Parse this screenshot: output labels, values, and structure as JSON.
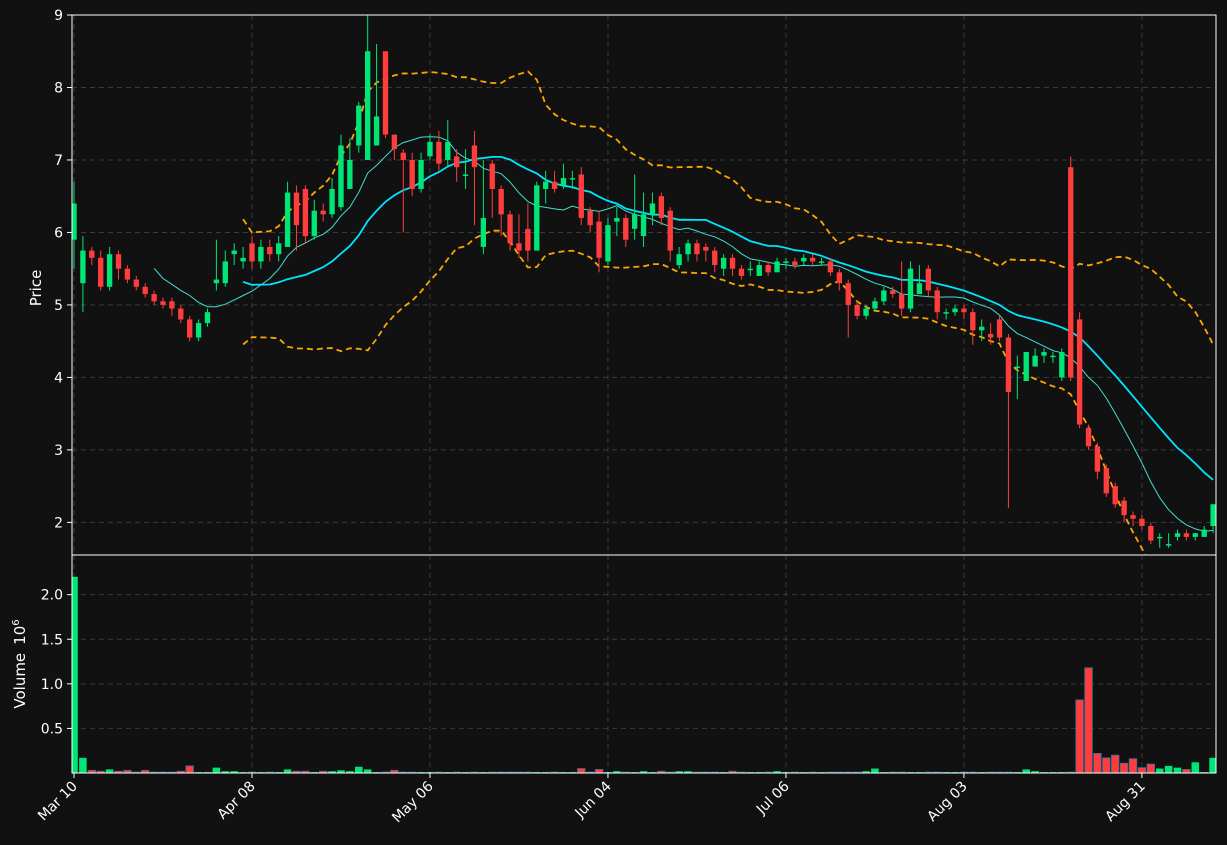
{
  "chart_data": {
    "type": "candlestick",
    "dates": [
      "Mar 10",
      "Mar 11",
      "Mar 12",
      "Mar 13",
      "Mar 14",
      "Mar 17",
      "Mar 18",
      "Mar 19",
      "Mar 20",
      "Mar 21",
      "Mar 24",
      "Mar 25",
      "Mar 26",
      "Mar 27",
      "Mar 28",
      "Mar 31",
      "Apr 01",
      "Apr 02",
      "Apr 03",
      "Apr 04",
      "Apr 07",
      "Apr 08",
      "Apr 09",
      "Apr 10",
      "Apr 11",
      "Apr 14",
      "Apr 15",
      "Apr 16",
      "Apr 17",
      "Apr 18",
      "Apr 21",
      "Apr 22",
      "Apr 23",
      "Apr 24",
      "Apr 25",
      "Apr 28",
      "Apr 29",
      "Apr 30",
      "May 01",
      "May 02",
      "May 05",
      "May 06",
      "May 07",
      "May 08",
      "May 09",
      "May 12",
      "May 13",
      "May 14",
      "May 15",
      "May 16",
      "May 19",
      "May 20",
      "May 21",
      "May 22",
      "May 23",
      "May 27",
      "May 28",
      "May 29",
      "May 30",
      "Jun 02",
      "Jun 03",
      "Jun 04",
      "Jun 05",
      "Jun 06",
      "Jun 09",
      "Jun 10",
      "Jun 11",
      "Jun 12",
      "Jun 13",
      "Jun 16",
      "Jun 17",
      "Jun 18",
      "Jun 19",
      "Jun 20",
      "Jun 23",
      "Jun 24",
      "Jun 25",
      "Jun 26",
      "Jun 27",
      "Jun 30",
      "Jul 01",
      "Jul 02",
      "Jul 03",
      "Jul 06",
      "Jul 07",
      "Jul 08",
      "Jul 09",
      "Jul 10",
      "Jul 11",
      "Jul 14",
      "Jul 15",
      "Jul 16",
      "Jul 17",
      "Jul 18",
      "Jul 21",
      "Jul 22",
      "Jul 23",
      "Jul 24",
      "Jul 25",
      "Jul 28",
      "Jul 29",
      "Jul 30",
      "Jul 31",
      "Aug 01",
      "Aug 03",
      "Aug 04",
      "Aug 05",
      "Aug 06",
      "Aug 07",
      "Aug 08",
      "Aug 11",
      "Aug 12",
      "Aug 13",
      "Aug 14",
      "Aug 15",
      "Aug 18",
      "Aug 19",
      "Aug 20",
      "Aug 21",
      "Aug 22",
      "Aug 25",
      "Aug 26",
      "Aug 27",
      "Aug 28",
      "Aug 29",
      "Aug 31",
      "Sep 01",
      "Sep 02",
      "Sep 03",
      "Sep 04",
      "Sep 05"
    ],
    "open": [
      5.9,
      5.3,
      5.75,
      5.65,
      5.25,
      5.7,
      5.5,
      5.35,
      5.25,
      5.15,
      5.05,
      5.05,
      4.95,
      4.8,
      4.55,
      4.75,
      5.3,
      5.3,
      5.7,
      5.6,
      5.85,
      5.6,
      5.8,
      5.7,
      5.8,
      6.55,
      6.6,
      5.95,
      6.3,
      6.25,
      6.35,
      6.6,
      7.2,
      7.0,
      7.2,
      8.5,
      7.35,
      7.1,
      7.0,
      6.6,
      7.05,
      7.25,
      7.0,
      7.05,
      6.8,
      7.2,
      5.8,
      6.95,
      6.6,
      6.25,
      5.85,
      6.05,
      5.75,
      6.6,
      6.7,
      6.65,
      6.75,
      6.8,
      6.3,
      6.15,
      5.6,
      6.15,
      6.2,
      6.05,
      5.95,
      6.25,
      6.5,
      6.3,
      5.55,
      5.7,
      5.85,
      5.8,
      5.75,
      5.5,
      5.65,
      5.5,
      5.5,
      5.4,
      5.55,
      5.45,
      5.6,
      5.6,
      5.6,
      5.65,
      5.6,
      5.6,
      5.45,
      5.3,
      5.0,
      4.85,
      4.95,
      5.05,
      5.2,
      5.15,
      4.95,
      5.15,
      5.5,
      5.2,
      4.9,
      4.9,
      4.95,
      4.9,
      4.65,
      4.6,
      4.8,
      4.55,
      4.15,
      3.95,
      4.15,
      4.3,
      4.3,
      4.0,
      6.9,
      4.8,
      3.3,
      3.05,
      2.75,
      2.5,
      2.3,
      2.1,
      2.05,
      1.95,
      1.8,
      1.7,
      1.8,
      1.85,
      1.8,
      1.8,
      1.95
    ],
    "close": [
      6.4,
      5.75,
      5.65,
      5.25,
      5.7,
      5.5,
      5.35,
      5.25,
      5.15,
      5.05,
      5.0,
      4.95,
      4.8,
      4.55,
      4.75,
      4.9,
      5.35,
      5.6,
      5.75,
      5.65,
      5.6,
      5.8,
      5.7,
      5.85,
      6.55,
      6.1,
      5.95,
      6.3,
      6.25,
      6.6,
      7.2,
      7.0,
      7.75,
      8.5,
      7.6,
      7.35,
      7.15,
      7.0,
      6.6,
      7.0,
      7.25,
      6.95,
      7.25,
      6.9,
      6.8,
      6.9,
      6.2,
      6.6,
      6.25,
      5.85,
      5.75,
      5.75,
      6.65,
      6.7,
      6.6,
      6.75,
      6.75,
      6.2,
      6.1,
      5.65,
      6.1,
      6.2,
      5.9,
      6.25,
      6.25,
      6.4,
      6.2,
      5.75,
      5.7,
      5.85,
      5.7,
      5.75,
      5.55,
      5.65,
      5.5,
      5.4,
      5.5,
      5.55,
      5.45,
      5.6,
      5.6,
      5.55,
      5.65,
      5.6,
      5.6,
      5.45,
      5.3,
      5.0,
      4.85,
      4.95,
      5.05,
      5.2,
      5.15,
      4.95,
      5.5,
      5.3,
      5.2,
      4.9,
      4.9,
      4.95,
      4.9,
      4.65,
      4.7,
      4.55,
      4.55,
      3.8,
      4.15,
      4.35,
      4.3,
      4.35,
      4.3,
      4.35,
      4.0,
      3.35,
      3.05,
      2.7,
      2.4,
      2.25,
      2.1,
      2.05,
      1.95,
      1.75,
      1.8,
      1.7,
      1.85,
      1.8,
      1.85,
      1.9,
      2.25
    ],
    "high": [
      6.7,
      5.95,
      5.8,
      5.75,
      5.8,
      5.75,
      5.55,
      5.4,
      5.3,
      5.2,
      5.1,
      5.1,
      5.0,
      4.85,
      4.8,
      4.95,
      5.9,
      5.75,
      5.85,
      5.8,
      5.95,
      5.9,
      5.9,
      5.95,
      6.7,
      6.65,
      6.65,
      6.45,
      6.4,
      6.75,
      7.35,
      7.3,
      7.8,
      9.0,
      8.6,
      7.5,
      7.3,
      7.15,
      7.1,
      7.1,
      7.35,
      7.4,
      7.55,
      7.15,
      7.15,
      7.4,
      7.0,
      7.0,
      6.65,
      6.3,
      6.25,
      6.4,
      6.7,
      6.85,
      6.85,
      6.95,
      6.85,
      6.9,
      6.35,
      6.3,
      6.2,
      6.35,
      6.25,
      6.8,
      6.55,
      6.55,
      6.55,
      6.35,
      5.8,
      5.9,
      5.9,
      5.85,
      5.8,
      5.7,
      5.7,
      5.55,
      5.6,
      5.6,
      5.6,
      5.65,
      5.65,
      5.65,
      5.7,
      5.7,
      5.65,
      5.65,
      5.5,
      5.35,
      5.05,
      5.0,
      5.1,
      5.25,
      5.25,
      5.6,
      5.6,
      5.55,
      5.55,
      5.25,
      4.95,
      5.0,
      5.0,
      4.95,
      4.8,
      4.75,
      4.85,
      4.6,
      4.3,
      4.35,
      4.4,
      4.4,
      4.35,
      4.4,
      7.05,
      4.9,
      3.35,
      3.1,
      2.8,
      2.55,
      2.35,
      2.15,
      2.1,
      2.0,
      1.85,
      1.85,
      1.9,
      1.9,
      1.85,
      1.95,
      2.25
    ],
    "low": [
      5.5,
      4.9,
      5.55,
      5.2,
      5.2,
      5.35,
      5.3,
      5.2,
      5.1,
      5.0,
      4.95,
      4.85,
      4.75,
      4.5,
      4.5,
      4.7,
      5.2,
      5.25,
      5.55,
      5.5,
      5.5,
      5.5,
      5.6,
      5.6,
      5.8,
      5.75,
      5.85,
      5.9,
      6.15,
      6.2,
      6.3,
      6.7,
      7.1,
      7.0,
      7.55,
      7.3,
      7.0,
      6.0,
      6.5,
      6.55,
      7.0,
      6.85,
      6.9,
      6.7,
      6.6,
      6.1,
      5.7,
      6.2,
      5.95,
      5.75,
      5.65,
      5.6,
      5.8,
      6.4,
      6.55,
      6.6,
      6.6,
      6.1,
      6.0,
      5.45,
      5.55,
      5.95,
      5.8,
      5.9,
      5.8,
      6.1,
      6.1,
      5.6,
      5.5,
      5.6,
      5.6,
      5.6,
      5.45,
      5.4,
      5.4,
      5.35,
      5.4,
      5.4,
      5.4,
      5.5,
      5.5,
      5.5,
      5.55,
      5.55,
      5.55,
      5.4,
      5.2,
      4.55,
      4.8,
      4.8,
      4.9,
      5.0,
      5.1,
      4.85,
      4.9,
      5.2,
      5.1,
      4.8,
      4.8,
      4.85,
      4.8,
      4.45,
      4.5,
      4.45,
      4.5,
      2.2,
      3.7,
      4.1,
      4.15,
      4.2,
      4.2,
      3.95,
      3.95,
      3.3,
      3.0,
      2.6,
      2.35,
      2.2,
      2.0,
      1.95,
      1.9,
      1.7,
      1.65,
      1.65,
      1.75,
      1.75,
      1.75,
      1.8,
      1.85
    ],
    "volume_millions": [
      2.2,
      0.17,
      0.03,
      0.02,
      0.04,
      0.02,
      0.03,
      0.01,
      0.03,
      0.01,
      0.01,
      0.01,
      0.02,
      0.08,
      0.01,
      0.01,
      0.06,
      0.02,
      0.02,
      0.01,
      0.01,
      0.01,
      0.01,
      0.01,
      0.04,
      0.02,
      0.02,
      0.01,
      0.02,
      0.02,
      0.03,
      0.02,
      0.07,
      0.04,
      0.01,
      0.01,
      0.03,
      0.01,
      0.01,
      0.01,
      0.01,
      0.01,
      0.01,
      0.01,
      0.01,
      0.01,
      0.01,
      0.01,
      0.01,
      0.01,
      0.01,
      0.01,
      0.01,
      0.01,
      0.01,
      0.01,
      0.01,
      0.05,
      0.01,
      0.04,
      0.01,
      0.02,
      0.01,
      0.01,
      0.02,
      0.01,
      0.02,
      0.01,
      0.02,
      0.02,
      0.01,
      0.01,
      0.01,
      0.01,
      0.02,
      0.01,
      0.01,
      0.01,
      0.01,
      0.02,
      0.01,
      0.01,
      0.01,
      0.01,
      0.01,
      0.01,
      0.01,
      0.01,
      0.01,
      0.02,
      0.05,
      0.01,
      0.01,
      0.01,
      0.01,
      0.01,
      0.01,
      0.01,
      0.01,
      0.01,
      0.01,
      0.01,
      0.01,
      0.01,
      0.01,
      0.01,
      0.01,
      0.04,
      0.02,
      0.01,
      0.01,
      0.01,
      0.01,
      0.82,
      1.18,
      0.22,
      0.17,
      0.2,
      0.11,
      0.16,
      0.06,
      0.1,
      0.05,
      0.08,
      0.06,
      0.04,
      0.12,
      0.01,
      0.17,
      0.09,
      0.15
    ],
    "x_ticks": [
      {
        "label": "Mar 10",
        "index": 0
      },
      {
        "label": "Apr 08",
        "index": 20
      },
      {
        "label": "May 06",
        "index": 40
      },
      {
        "label": "Jun 04",
        "index": 60
      },
      {
        "label": "Jul 06",
        "index": 80
      },
      {
        "label": "Aug 03",
        "index": 100
      },
      {
        "label": "Aug 31",
        "index": 120
      }
    ],
    "price_axis": {
      "label": "Price",
      "ylim": [
        1.55,
        9.0
      ],
      "ticks": [
        2,
        3,
        4,
        5,
        6,
        7,
        8,
        9
      ]
    },
    "volume_axis": {
      "label": "Volume",
      "unit_power": "6",
      "ylim": [
        0,
        2.4
      ],
      "ticks": [
        {
          "value": 0.5,
          "label": "0.5"
        },
        {
          "value": 1.0,
          "label": "1.0"
        },
        {
          "value": 1.5,
          "label": "1.5"
        },
        {
          "value": 2.0,
          "label": "2.0"
        }
      ]
    },
    "overlays": {
      "ma_short_period": 10,
      "ma_long_period": 20,
      "bollinger_period": 20,
      "bollinger_std": 2
    },
    "grid": true
  },
  "colors": {
    "background": "#111111",
    "up": "#00e676",
    "down": "#ff3d3d",
    "ma_short": "#40e0d0",
    "ma_long": "#00e5ff",
    "bollinger": "#ffa500",
    "grid": "#3a3a3a",
    "axis": "#ffffff"
  }
}
